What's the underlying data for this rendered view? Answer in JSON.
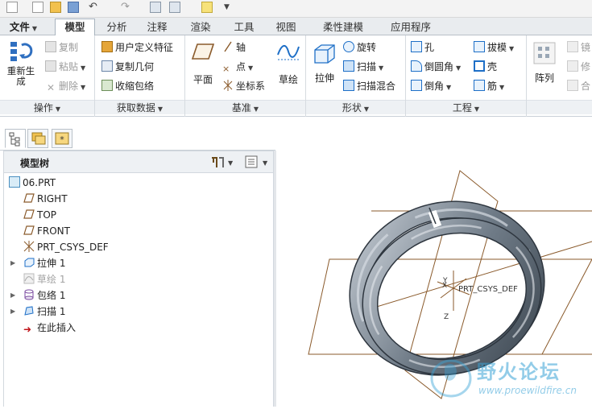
{
  "tabs": [
    "文件",
    "模型",
    "分析",
    "注释",
    "渲染",
    "工具",
    "视图",
    "柔性建模",
    "应用程序"
  ],
  "active_tab": "模型",
  "groups": {
    "operations": {
      "label": "操作",
      "regenerate": "重新生成",
      "copy": "复制",
      "paste": "粘贴",
      "delete": "删除"
    },
    "get_data": {
      "label": "获取数据",
      "udf": "用户定义特征",
      "copy_geom": "复制几何",
      "shrinkwrap": "收缩包络"
    },
    "datum": {
      "label": "基准",
      "plane": "平面",
      "axis": "轴",
      "point": "点",
      "csys": "坐标系",
      "sketch": "草绘"
    },
    "shapes": {
      "label": "形状",
      "extrude": "拉伸",
      "revolve": "旋转",
      "sweep": "扫描",
      "swept_blend": "扫描混合"
    },
    "engineering": {
      "label": "工程",
      "hole": "孔",
      "round": "倒圆角",
      "chamfer": "倒角",
      "draft": "拔模",
      "shell": "壳",
      "rib": "筋"
    },
    "editing": {
      "pattern": "阵列",
      "mirror": "镜",
      "modify": "修",
      "merge": "合"
    }
  },
  "model_tree": {
    "title": "模型树",
    "items": [
      {
        "label": "06.PRT",
        "icon": "part-icon",
        "disabled": false,
        "expandable": false
      },
      {
        "label": "RIGHT",
        "icon": "datum-plane-icon",
        "disabled": false,
        "expandable": false
      },
      {
        "label": "TOP",
        "icon": "datum-plane-icon",
        "disabled": false,
        "expandable": false
      },
      {
        "label": "FRONT",
        "icon": "datum-plane-icon",
        "disabled": false,
        "expandable": false
      },
      {
        "label": "PRT_CSYS_DEF",
        "icon": "csys-icon",
        "disabled": false,
        "expandable": false
      },
      {
        "label": "拉伸 1",
        "icon": "extrude-icon",
        "disabled": false,
        "expandable": true
      },
      {
        "label": "草绘 1",
        "icon": "sketch-icon",
        "disabled": true,
        "expandable": false
      },
      {
        "label": "包络 1",
        "icon": "wrap-icon",
        "disabled": false,
        "expandable": true
      },
      {
        "label": "扫描 1",
        "icon": "sweep-icon",
        "disabled": false,
        "expandable": true
      },
      {
        "label": "在此插入",
        "icon": "insert-arrow-icon",
        "disabled": false,
        "expandable": false
      }
    ]
  },
  "viewport": {
    "csys_label": "PRT_CSYS_DEF",
    "axis_x": "X",
    "axis_y": "Y",
    "axis_z": "Z"
  },
  "watermark": {
    "title": "野火论坛",
    "url": "www.proewildfire.cn"
  },
  "colors": {
    "accent": "#1e6fc7",
    "datum": "#8a5a2b",
    "model": "#707a86",
    "watermark": "#3aa3d6"
  }
}
